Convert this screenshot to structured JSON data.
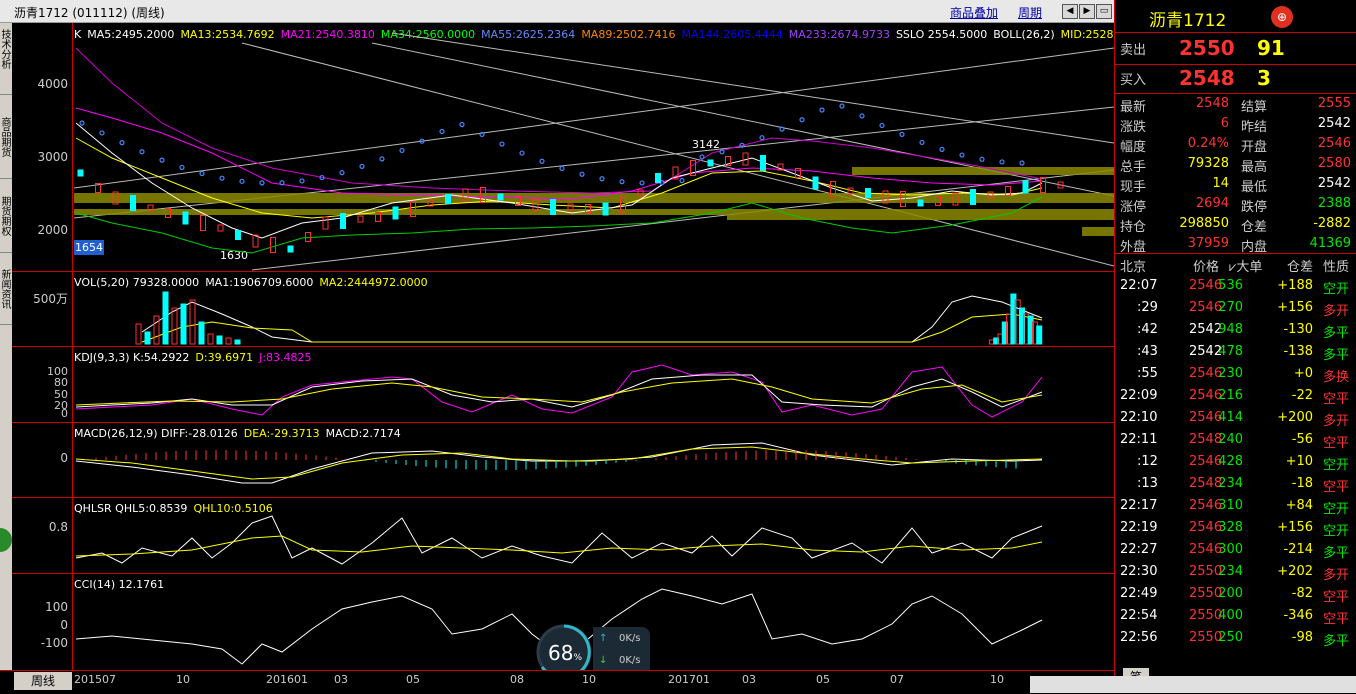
{
  "window": {
    "title": "沥青1712 (011112) (周线)",
    "overlay_link": "商品叠加",
    "period_link": "周期"
  },
  "left_tabs": [
    "技术分析",
    "商品期货",
    "期货期权",
    "新闻资讯"
  ],
  "main_panel": {
    "legend": [
      {
        "text": "K",
        "color": "#ffffff"
      },
      {
        "text": "MA5:2495.2000",
        "color": "#ffffff"
      },
      {
        "text": "MA13:2534.7692",
        "color": "#ffff00"
      },
      {
        "text": "MA21:2540.3810",
        "color": "#ff00ff"
      },
      {
        "text": "MA34:2560.0000",
        "color": "#00ff00"
      },
      {
        "text": "MA55:2625.2364",
        "color": "#6688ff"
      },
      {
        "text": "MA89:2502.7416",
        "color": "#ff8800"
      },
      {
        "text": "MA144:2605.4444",
        "color": "#0000ff"
      },
      {
        "text": "MA233:2674.9733",
        "color": "#a040ff"
      },
      {
        "text": "SSLO 2554.5000",
        "color": "#ffffff"
      },
      {
        "text": "BOLL(26,2)",
        "color": "#ffffff"
      },
      {
        "text": "MID:2528",
        "color": "#ffff00"
      }
    ],
    "y_labels": [
      "4000",
      "3000",
      "2000"
    ],
    "current_price_tag": "1654",
    "high_marker": "3142",
    "low_marker": "1630"
  },
  "vol_panel": {
    "legend": [
      {
        "text": "VOL(5,20) 79328.0000",
        "color": "#ffffff"
      },
      {
        "text": "MA1:1906709.6000",
        "color": "#ffffff"
      },
      {
        "text": "MA2:2444972.0000",
        "color": "#ffff00"
      }
    ],
    "y_label": "500万"
  },
  "kdj_panel": {
    "legend": [
      {
        "text": "KDJ(9,3,3) K:54.2922",
        "color": "#ffffff"
      },
      {
        "text": "D:39.6971",
        "color": "#ffff00"
      },
      {
        "text": "J:83.4825",
        "color": "#ff00ff"
      }
    ],
    "y_labels": [
      "100",
      "80",
      "50",
      "20",
      "0"
    ]
  },
  "macd_panel": {
    "legend": [
      {
        "text": "MACD(26,12,9) DIFF:-28.0126",
        "color": "#ffffff"
      },
      {
        "text": "DEA:-29.3713",
        "color": "#ffff00"
      },
      {
        "text": "MACD:2.7174",
        "color": "#ffffff"
      }
    ],
    "y_label": "0"
  },
  "qhlsr_panel": {
    "legend": [
      {
        "text": "QHLSR QHL5:0.8539",
        "color": "#ffffff"
      },
      {
        "text": "QHL10:0.5106",
        "color": "#ffff00"
      }
    ],
    "y_label": "0.8"
  },
  "cci_panel": {
    "legend": [
      {
        "text": "CCI(14) 12.1761",
        "color": "#ffffff"
      }
    ],
    "y_labels": [
      "100",
      "0",
      "-100"
    ]
  },
  "x_axis": {
    "period": "周线",
    "labels": [
      "201507",
      "10",
      "201601",
      "03",
      "05",
      "08",
      "10",
      "201701",
      "03",
      "05",
      "07",
      "10"
    ]
  },
  "speed_widget": {
    "percent": "68",
    "unit": "%",
    "up": "0K/s",
    "down": "0K/s"
  },
  "quote": {
    "name": "沥青1712",
    "sell_label": "卖出",
    "sell_price": "2550",
    "sell_qty": "91",
    "buy_label": "买入",
    "buy_price": "2548",
    "buy_qty": "3",
    "rows": [
      {
        "l1": "最新",
        "v1": "2548",
        "c1": "red",
        "l2": "结算",
        "v2": "2555",
        "c2": "red"
      },
      {
        "l1": "涨跌",
        "v1": "6",
        "c1": "red",
        "l2": "昨结",
        "v2": "2542",
        "c2": "white"
      },
      {
        "l1": "幅度",
        "v1": "0.24%",
        "c1": "red",
        "l2": "开盘",
        "v2": "2546",
        "c2": "red"
      },
      {
        "l1": "总手",
        "v1": "79328",
        "c1": "yellow",
        "l2": "最高",
        "v2": "2580",
        "c2": "red"
      },
      {
        "l1": "现手",
        "v1": "14",
        "c1": "yellow",
        "l2": "最低",
        "v2": "2542",
        "c2": "white"
      },
      {
        "l1": "涨停",
        "v1": "2694",
        "c1": "red",
        "l2": "跌停",
        "v2": "2388",
        "c2": "green"
      },
      {
        "l1": "持仓",
        "v1": "298850",
        "c1": "yellow",
        "l2": "仓差",
        "v2": "-2882",
        "c2": "yellow"
      },
      {
        "l1": "外盘",
        "v1": "37959",
        "c1": "red",
        "l2": "内盘",
        "v2": "41369",
        "c2": "green"
      }
    ],
    "tick_header": {
      "time": "北京",
      "price": "价格",
      "vol": "⩗大单",
      "oi": "仓差",
      "nature": "性质"
    },
    "ticks": [
      {
        "time": "22:07",
        "price": "2546",
        "pc": "red",
        "vol": "536",
        "oi": "+188",
        "nature": "空开",
        "nc": "green"
      },
      {
        "time": ":29",
        "price": "2546",
        "pc": "red",
        "vol": "270",
        "oi": "+156",
        "nature": "多开",
        "nc": "red"
      },
      {
        "time": ":42",
        "price": "2542",
        "pc": "white",
        "vol": "948",
        "oi": "-130",
        "nature": "多平",
        "nc": "green"
      },
      {
        "time": ":43",
        "price": "2542",
        "pc": "white",
        "vol": "478",
        "oi": "-138",
        "nature": "多平",
        "nc": "green"
      },
      {
        "time": ":55",
        "price": "2546",
        "pc": "red",
        "vol": "230",
        "oi": "+0",
        "nature": "多换",
        "nc": "red"
      },
      {
        "time": "22:09",
        "price": "2546",
        "pc": "red",
        "vol": "216",
        "oi": "-22",
        "nature": "空平",
        "nc": "red"
      },
      {
        "time": "22:10",
        "price": "2546",
        "pc": "red",
        "vol": "414",
        "oi": "+200",
        "nature": "多开",
        "nc": "red"
      },
      {
        "time": "22:11",
        "price": "2548",
        "pc": "red",
        "vol": "240",
        "oi": "-56",
        "nature": "空平",
        "nc": "red"
      },
      {
        "time": ":12",
        "price": "2546",
        "pc": "red",
        "vol": "428",
        "oi": "+10",
        "nature": "空开",
        "nc": "green"
      },
      {
        "time": ":13",
        "price": "2548",
        "pc": "red",
        "vol": "234",
        "oi": "-18",
        "nature": "空平",
        "nc": "red"
      },
      {
        "time": "22:17",
        "price": "2546",
        "pc": "red",
        "vol": "310",
        "oi": "+84",
        "nature": "空开",
        "nc": "green"
      },
      {
        "time": "22:19",
        "price": "2546",
        "pc": "red",
        "vol": "328",
        "oi": "+156",
        "nature": "空开",
        "nc": "green"
      },
      {
        "time": "22:27",
        "price": "2546",
        "pc": "red",
        "vol": "300",
        "oi": "-214",
        "nature": "多平",
        "nc": "green"
      },
      {
        "time": "22:30",
        "price": "2550",
        "pc": "red",
        "vol": "234",
        "oi": "+202",
        "nature": "多开",
        "nc": "red"
      },
      {
        "time": "22:49",
        "price": "2550",
        "pc": "red",
        "vol": "200",
        "oi": "-82",
        "nature": "空平",
        "nc": "red"
      },
      {
        "time": "22:54",
        "price": "2550",
        "pc": "red",
        "vol": "400",
        "oi": "-346",
        "nature": "空平",
        "nc": "red"
      },
      {
        "time": "22:56",
        "price": "2550",
        "pc": "red",
        "vol": "250",
        "oi": "-98",
        "nature": "多平",
        "nc": "green"
      }
    ],
    "bottom_tab": "笔"
  },
  "colors": {
    "up": "#ff3232",
    "down": "#00ffff",
    "grid": "#cc0000",
    "bg": "#000000"
  }
}
